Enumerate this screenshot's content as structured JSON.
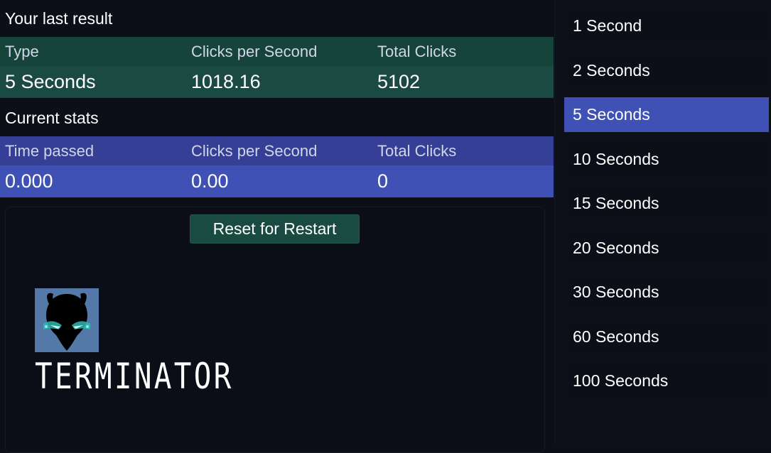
{
  "last_result": {
    "title": "Your last result",
    "headers": [
      "Type",
      "Clicks per Second",
      "Total Clicks"
    ],
    "values": [
      "5 Seconds",
      "1018.16",
      "5102"
    ]
  },
  "current_stats": {
    "title": "Current stats",
    "headers": [
      "Time passed",
      "Clicks per Second",
      "Total Clicks"
    ],
    "values": [
      "0.000",
      "0.00",
      "0"
    ]
  },
  "click_area": {
    "reset_label": "Reset for Restart",
    "logo_text": "TERMINATOR"
  },
  "modes": [
    {
      "label": "1 Second",
      "active": false
    },
    {
      "label": "2 Seconds",
      "active": false
    },
    {
      "label": "5 Seconds",
      "active": true
    },
    {
      "label": "10 Seconds",
      "active": false
    },
    {
      "label": "15 Seconds",
      "active": false
    },
    {
      "label": "20 Seconds",
      "active": false
    },
    {
      "label": "30 Seconds",
      "active": false
    },
    {
      "label": "60 Seconds",
      "active": false
    },
    {
      "label": "100 Seconds",
      "active": false
    }
  ],
  "colors": {
    "background": "#0c0e18",
    "green_header": "#17443a",
    "green_row": "#1a4a41",
    "blue_header": "#363f96",
    "blue_row": "#3f51b5",
    "accent": "#3f51b5"
  }
}
